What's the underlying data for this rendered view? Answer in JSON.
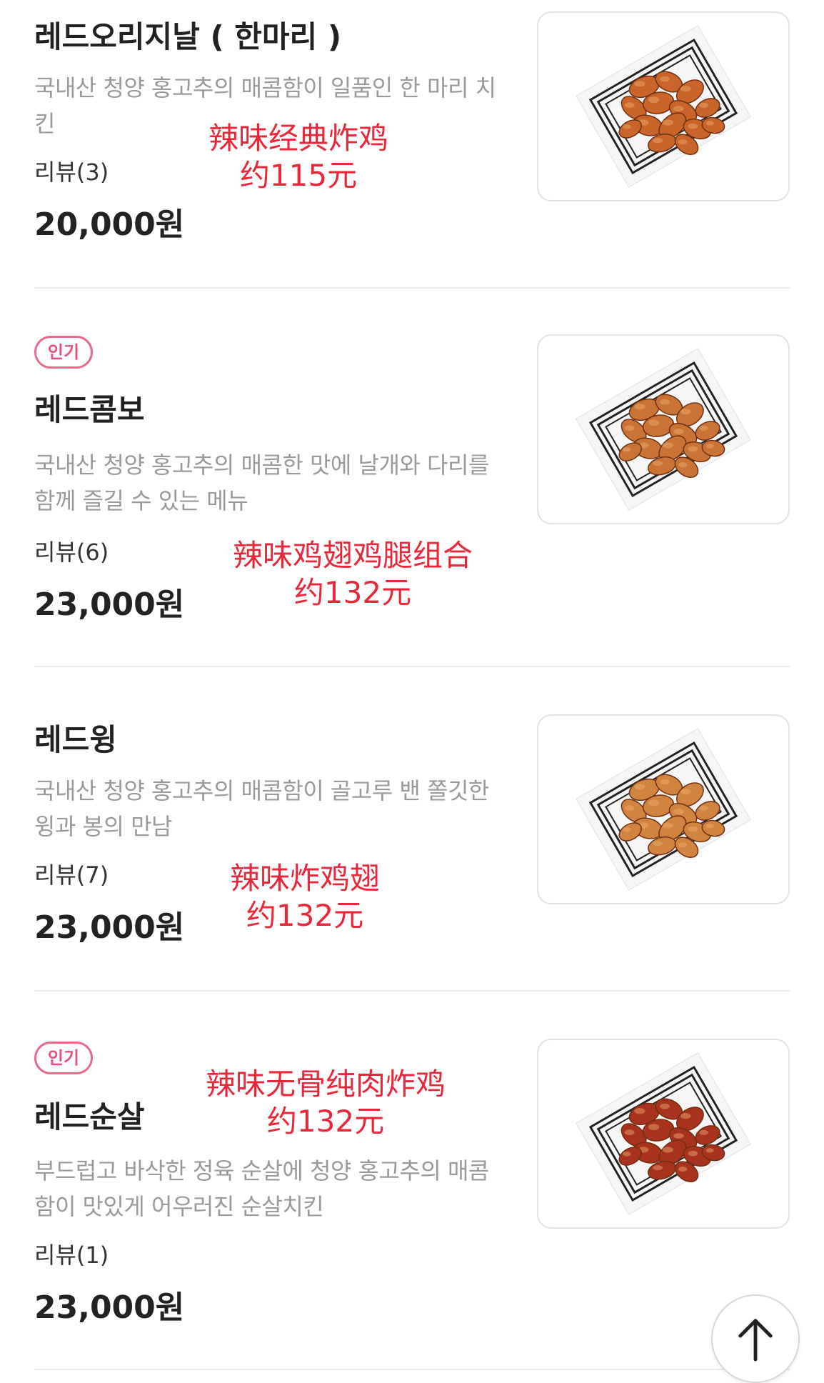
{
  "menu_items": [
    {
      "badge": "",
      "name": "레드오리지날 ( 한마리 )",
      "description": "국내산 청양 홍고추의 매콤함이 일품인 한 마리 치킨",
      "reviews": "리뷰(3)",
      "price": "20,000원",
      "annotation_line1": "辣味经典炸鸡",
      "annotation_line2": "约115元",
      "image_icon": "fried-chicken-basket-icon",
      "chicken_color": "#c9652a"
    },
    {
      "badge": "인기",
      "name": "레드콤보",
      "description": "국내산 청양 홍고추의 매콤한 맛에 날개와 다리를 함께 즐길 수 있는 메뉴",
      "reviews": "리뷰(6)",
      "price": "23,000원",
      "annotation_line1": "辣味鸡翅鸡腿组合",
      "annotation_line2": "约132元",
      "image_icon": "fried-chicken-basket-icon",
      "chicken_color": "#c97436"
    },
    {
      "badge": "",
      "name": "레드윙",
      "description": "국내산 청양 홍고추의 매콤함이 골고루 밴 쫄깃한 윙과 봉의 만남",
      "reviews": "리뷰(7)",
      "price": "23,000원",
      "annotation_line1": "辣味炸鸡翅",
      "annotation_line2": "约132元",
      "image_icon": "fried-chicken-basket-icon",
      "chicken_color": "#d0843f"
    },
    {
      "badge": "인기",
      "name": "레드순살",
      "description": "부드럽고 바삭한 정육 순살에 청양 홍고추의 매콤함이 맛있게 어우러진 순살치킨",
      "reviews": "리뷰(1)",
      "price": "23,000원",
      "annotation_line1": "辣味无骨纯肉炸鸡",
      "annotation_line2": "约132元",
      "image_icon": "fried-chicken-basket-icon",
      "chicken_color": "#a8321e"
    }
  ],
  "scroll_top_icon": "arrow-up-icon",
  "colors": {
    "badge": "#e6507a",
    "annotation": "#e8283a",
    "description": "#9a9a9a",
    "divider": "#ebebeb"
  }
}
